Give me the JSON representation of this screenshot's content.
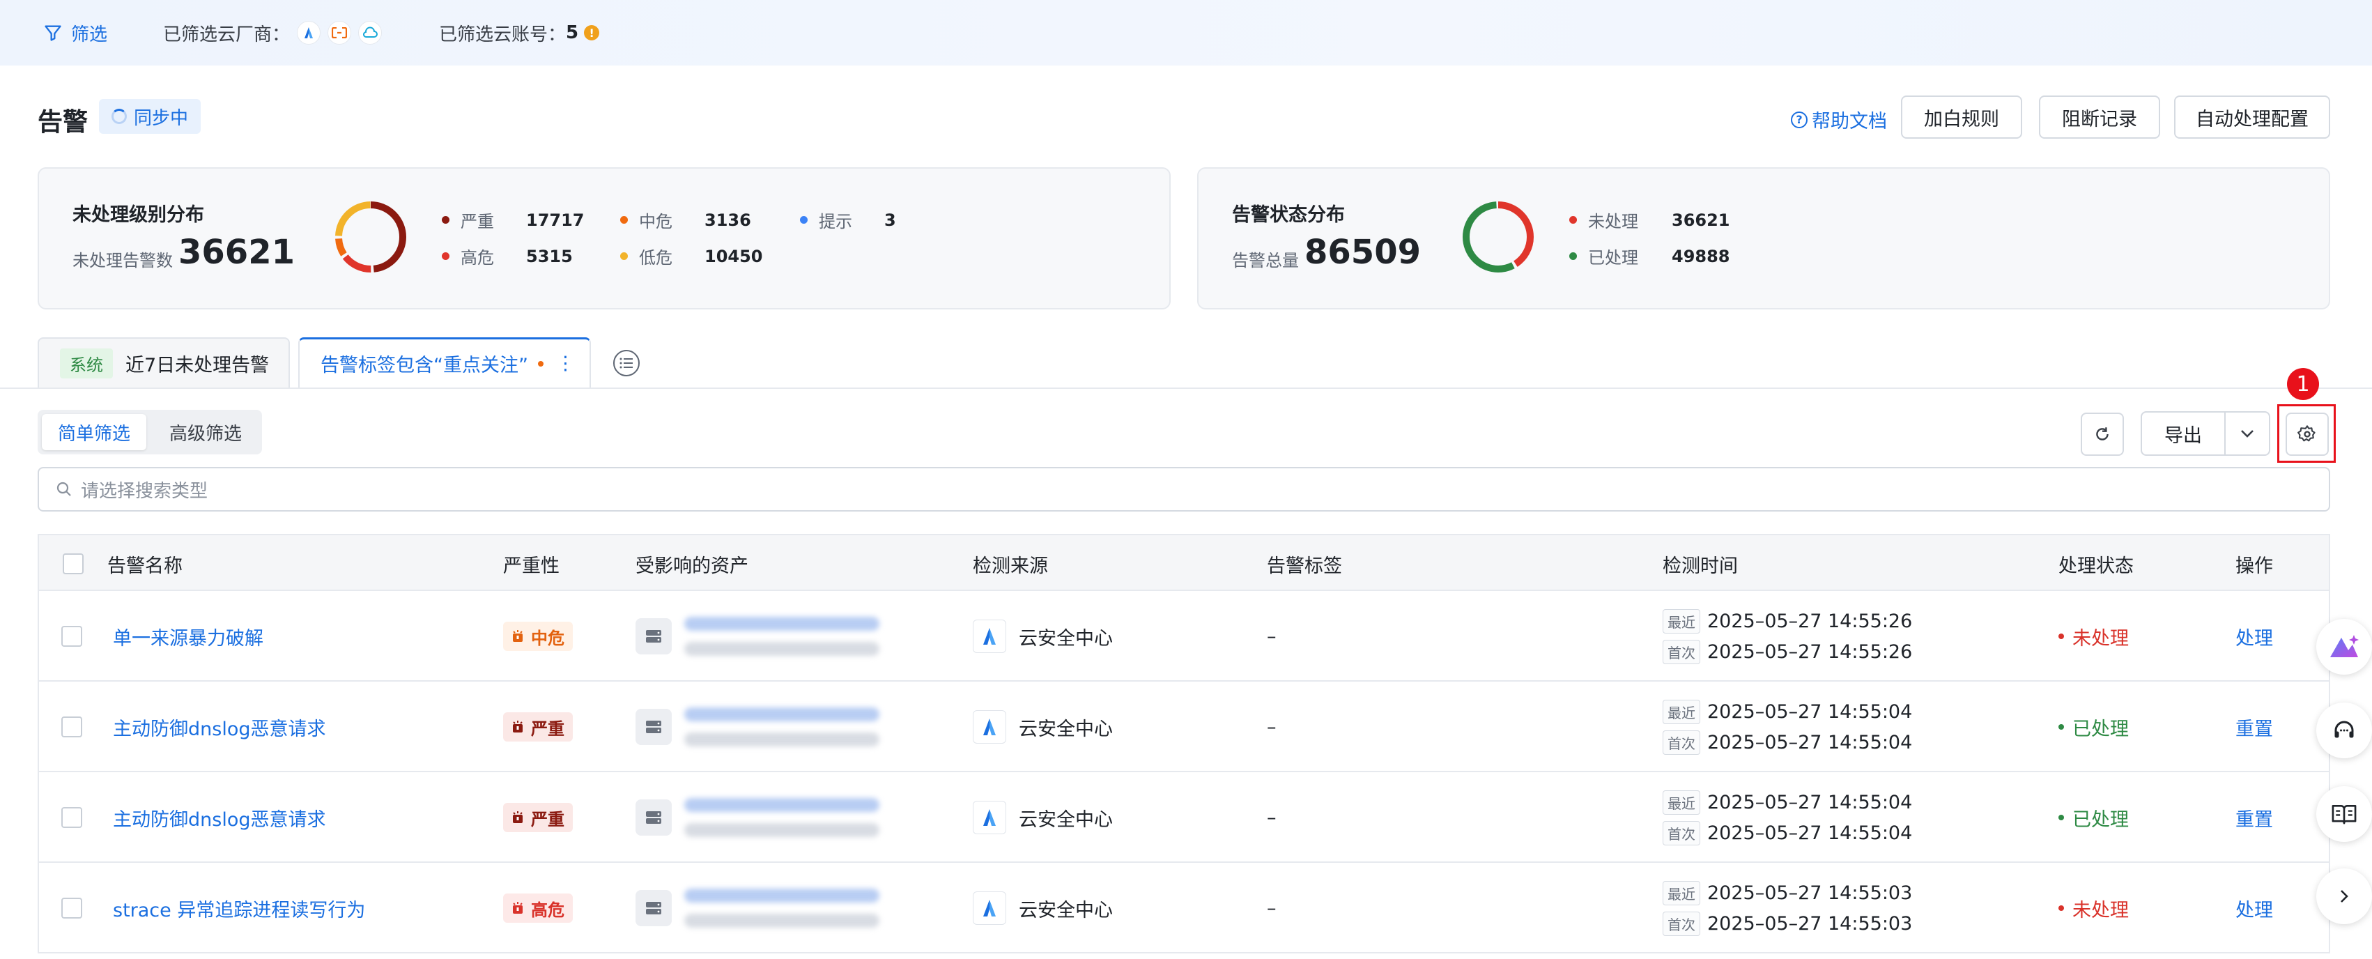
{
  "topbar": {
    "filter_label": "筛选",
    "vendors_label": "已筛选云厂商：",
    "accounts_label": "已筛选云账号：",
    "accounts_count": "5",
    "warn_mark": "!"
  },
  "header": {
    "title": "告警",
    "sync_status": "同步中",
    "help_label": "帮助文档",
    "whitelist_button": "加白规则",
    "block_record_button": "阻断记录",
    "auto_config_button": "自动处理配置"
  },
  "level_card": {
    "title": "未处理级别分布",
    "sub_label": "未处理告警数",
    "total": "36621",
    "legend": [
      {
        "label": "严重",
        "value": "17717",
        "color": "#8b1a10"
      },
      {
        "label": "中危",
        "value": "3136",
        "color": "#f06a0f"
      },
      {
        "label": "提示",
        "value": "3",
        "color": "#3b82f6"
      },
      {
        "label": "高危",
        "value": "5315",
        "color": "#e0352b"
      },
      {
        "label": "低危",
        "value": "10450",
        "color": "#f2b32a"
      }
    ]
  },
  "status_card": {
    "title": "告警状态分布",
    "sub_label": "告警总量",
    "total": "86509",
    "legend": [
      {
        "label": "未处理",
        "value": "36621",
        "color": "#e0352b"
      },
      {
        "label": "已处理",
        "value": "49888",
        "color": "#2e8a44"
      }
    ]
  },
  "tabs": [
    {
      "tag": "系统",
      "label": "近7日未处理告警"
    },
    {
      "label": "告警标签包含“重点关注”",
      "more": "⋮"
    }
  ],
  "toolbar": {
    "simple_filter": "简单筛选",
    "advanced_filter": "高级筛选",
    "export_label": "导出",
    "settings_badge": "1",
    "search_placeholder": "请选择搜索类型"
  },
  "table": {
    "headers": {
      "name": "告警名称",
      "severity": "严重性",
      "asset": "受影响的资产",
      "source": "检测来源",
      "tags": "告警标签",
      "time": "检测时间",
      "status": "处理状态",
      "action": "操作"
    },
    "recent_label": "最近",
    "first_label": "首次",
    "rows": [
      {
        "name": "单一来源暴力破解",
        "severity": "中危",
        "source": "云安全中心",
        "tags": "–",
        "recent": "2025–05–27 14:55:26",
        "first": "2025–05–27 14:55:26",
        "status": "未处理",
        "action": "处理"
      },
      {
        "name": "主动防御dnslog恶意请求",
        "severity": "严重",
        "source": "云安全中心",
        "tags": "–",
        "recent": "2025–05–27 14:55:04",
        "first": "2025–05–27 14:55:04",
        "status": "已处理",
        "action": "重置"
      },
      {
        "name": "主动防御dnslog恶意请求",
        "severity": "严重",
        "source": "云安全中心",
        "tags": "–",
        "recent": "2025–05–27 14:55:04",
        "first": "2025–05–27 14:55:04",
        "status": "已处理",
        "action": "重置"
      },
      {
        "name": "strace 异常追踪进程读写行为",
        "severity": "高危",
        "source": "云安全中心",
        "tags": "–",
        "recent": "2025–05–27 14:55:03",
        "first": "2025–05–27 14:55:03",
        "status": "未处理",
        "action": "处理"
      }
    ]
  },
  "colors": {
    "accent": "#1b6fe0",
    "critical": "#8b1a10",
    "high": "#e0352b",
    "medium": "#f06a0f",
    "low": "#f2b32a",
    "done": "#2e8a44"
  }
}
